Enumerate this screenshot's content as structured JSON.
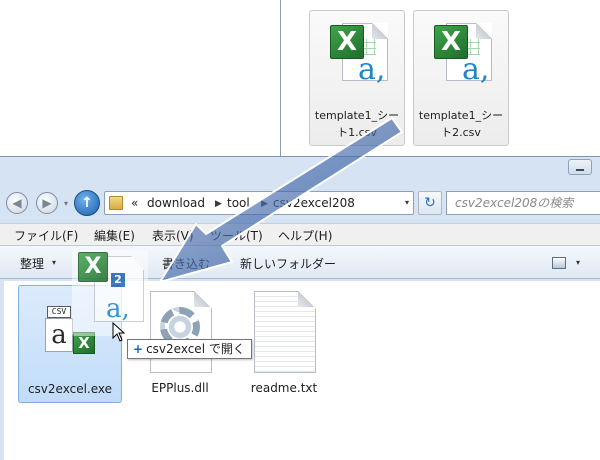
{
  "back_window": {
    "files": [
      {
        "line1": "template1_シー",
        "line2": "ト1.csv",
        "icon": "excel-csv-icon"
      },
      {
        "line1": "template1_シー",
        "line2": "ト2.csv",
        "icon": "excel-csv-icon"
      }
    ]
  },
  "nav": {
    "back_symbol": "◀",
    "forward_symbol": "▶",
    "dropdown_symbol": "▾",
    "up_symbol": "↑",
    "refresh_symbol": "↻"
  },
  "address": {
    "overflow": "«",
    "crumbs": [
      "download",
      "tool",
      "csv2excel208"
    ],
    "separator": "▶",
    "dropdown": "▾"
  },
  "search": {
    "placeholder": "csv2excel208の検索"
  },
  "menu": [
    "ファイル(F)",
    "編集(E)",
    "表示(V)",
    "ツール(T)",
    "ヘルプ(H)"
  ],
  "toolbar": {
    "organize": "整理",
    "write": "書き込む",
    "new_folder": "新しいフォルダー",
    "dropdown": "▾"
  },
  "files": [
    {
      "name": "csv2excel.exe",
      "icon": "csv2excel-app-icon",
      "selected": true,
      "csv_text": "CSV",
      "letter": "a"
    },
    {
      "name": "EPPlus.dll",
      "icon": "dll-gear-icon"
    },
    {
      "name": "readme.txt",
      "icon": "text-file-icon"
    }
  ],
  "drag": {
    "count": "2",
    "tooltip": "csv2excel で開く",
    "plus": "+"
  },
  "colors": {
    "accent": "#1f64b4",
    "excel_green": "#1e6e2c",
    "selection": "#c1dcfa",
    "window_frame": "#d6e3f2"
  }
}
